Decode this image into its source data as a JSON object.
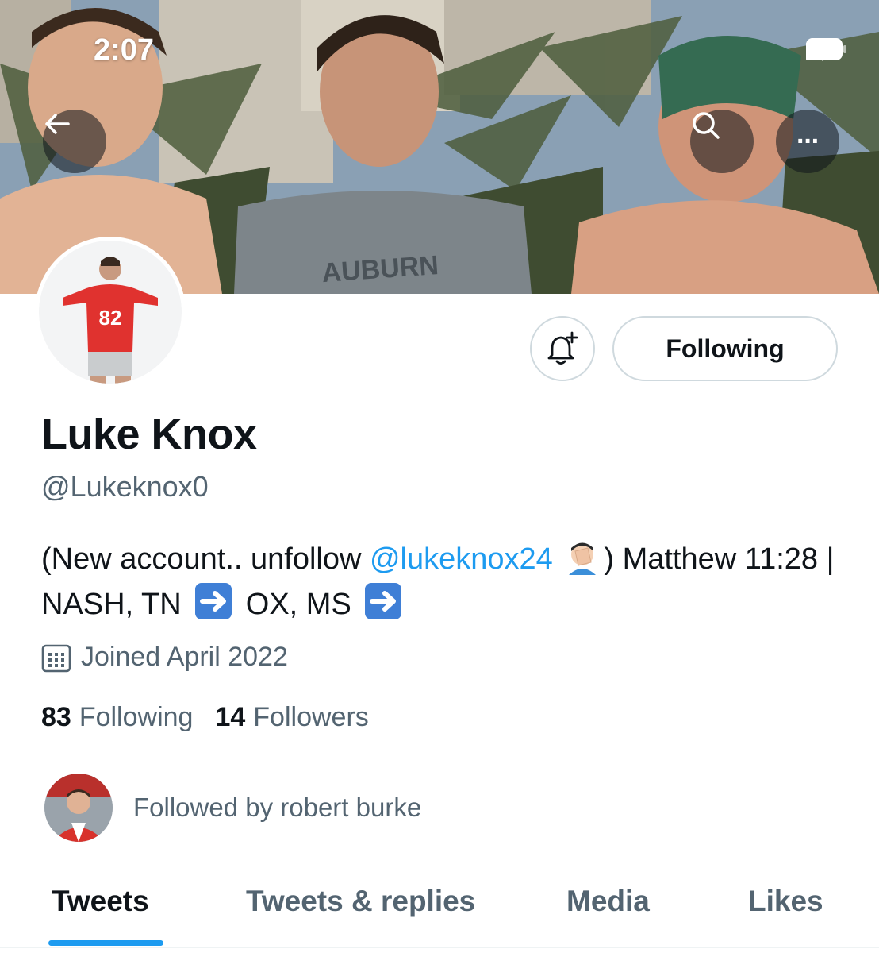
{
  "status_bar": {
    "time": "2:07",
    "icons": [
      "cellular-signal-icon",
      "wifi-icon",
      "battery-icon"
    ]
  },
  "header": {
    "back_icon": "arrow-left-icon",
    "search_icon": "search-icon",
    "more_icon": "more-horizontal-icon",
    "more_glyph": "···"
  },
  "banner": {
    "shirt_text": "AUBURN"
  },
  "avatar": {
    "jersey_number": "82"
  },
  "actions": {
    "notify_icon": "bell-plus-icon",
    "following_label": "Following"
  },
  "profile": {
    "display_name": "Luke Knox",
    "handle": "@Lukeknox0",
    "bio": {
      "part1": "(New account.. unfollow ",
      "mention": "@lukeknox24",
      "emoji": "man-facepalming-emoji",
      "part2": ") Matthew 11:28 | NASH, TN ",
      "arrow_emoji": "right-arrow-emoji",
      "part3": " OX, MS "
    },
    "joined_icon": "calendar-icon",
    "joined": "Joined April 2022",
    "following_count": "83",
    "following_label": "Following",
    "followers_count": "14",
    "followers_label": "Followers",
    "followed_by": "Followed by robert burke"
  },
  "tabs": [
    {
      "label": "Tweets",
      "active": true
    },
    {
      "label": "Tweets & replies",
      "active": false
    },
    {
      "label": "Media",
      "active": false
    },
    {
      "label": "Likes",
      "active": false
    }
  ],
  "colors": {
    "accent": "#1d9bf0",
    "text_primary": "#0f1419",
    "text_secondary": "#536471",
    "border": "#cfd9de"
  }
}
